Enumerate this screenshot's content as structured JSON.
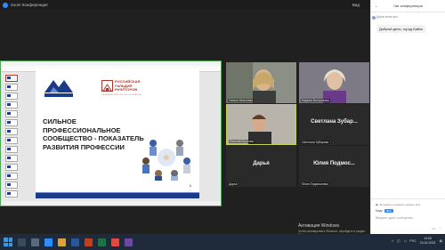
{
  "titlebar": {
    "title": "Zoom Конференция",
    "view": "Вид"
  },
  "slide": {
    "guild_name": "РОССИЙСКАЯ ГИЛЬДИЯ РИЭЛТОРОВ",
    "guild_sub": "ОБЪЕДИНЕНИЕ ПРОФЕССИОНАЛОВ",
    "headline": "СИЛЬНОЕ ПРОФЕССИОНАЛЬНОЕ СООБЩЕСТВО - ПОКАЗАТЕЛЬ РАЗВИТИЯ ПРОФЕССИИ",
    "page": "1"
  },
  "tiles": [
    {
      "name": "Галина Моисеева",
      "label": "",
      "video": true
    },
    {
      "name": "Марина Вострикова",
      "label": "",
      "video": true
    },
    {
      "name": "Евгений Шулепов",
      "label": "",
      "video": true,
      "active": true
    },
    {
      "name": "Светлана Зубарева",
      "label": "Светлана Зубар...",
      "video": false
    },
    {
      "name": "Дарья",
      "label": "Дарья",
      "video": false
    },
    {
      "name": "Юлия Подмосковья",
      "label": "Юлия Подмос...",
      "video": false
    }
  ],
  "chat": {
    "header": "Чат конференции",
    "message_from": "Дарья вcем мое",
    "message_text": "Добрый день, город Бийск",
    "note": "Вы можете сохранить журнал чата",
    "to_label": "Кому:",
    "to_value": "Все",
    "input_placeholder": "Введите здесь сообщение..."
  },
  "activation": {
    "title": "Активация Windows",
    "subtitle": "Чтобы активировать Windows, перейдите в раздел \"Параметры\"."
  },
  "taskbar": {
    "time": "14:00",
    "date": "23.04.2021",
    "lang": "РУС"
  },
  "colors": {
    "accent": "#2d8cff",
    "active_speaker": "#c2d44a",
    "slide_blue": "#1a3a8a",
    "guild_red": "#b0352a"
  }
}
